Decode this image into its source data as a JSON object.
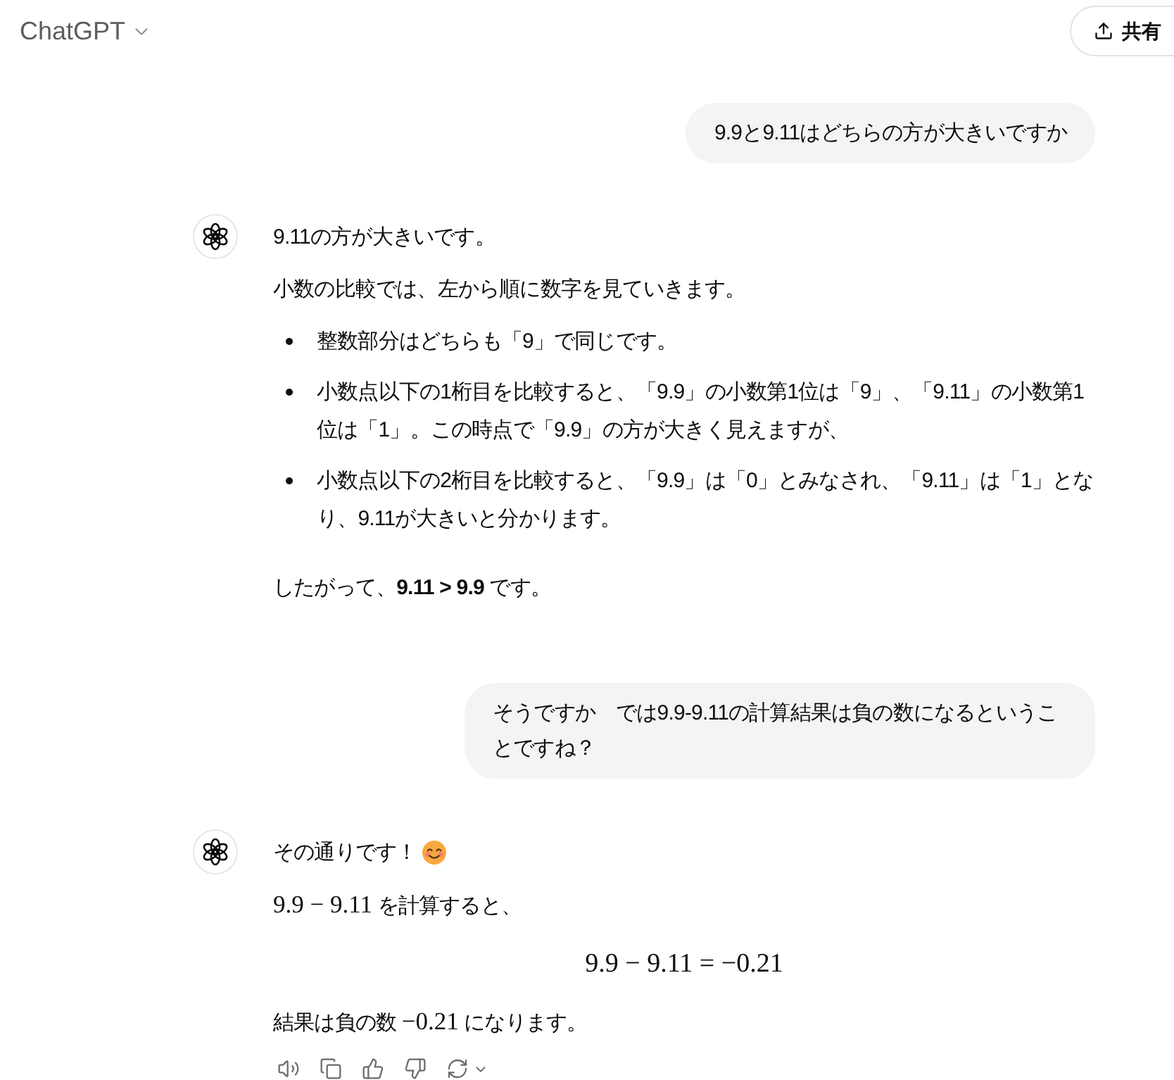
{
  "header": {
    "title": "ChatGPT",
    "share_button": "共有"
  },
  "messages": [
    {
      "kind": "user",
      "text": "9.9と9.11はどちらの方が大きいですか"
    },
    {
      "kind": "assistant",
      "blocks": [
        {
          "kind": "paragraph",
          "text": "9.11の方が大きいです。"
        },
        {
          "kind": "paragraph",
          "text": "小数の比較では、左から順に数字を見ていきます。"
        },
        {
          "kind": "list",
          "items": [
            "整数部分はどちらも「9」で同じです。",
            "小数点以下の1桁目を比較すると、「9.9」の小数第1位は「9」、「9.11」の小数第1位は「1」。この時点で「9.9」の方が大きく見えますが、",
            "小数点以下の2桁目を比較すると、「9.9」は「0」とみなされ、「9.11」は「1」となり、9.11が大きいと分かります。"
          ]
        },
        {
          "kind": "paragraph",
          "text": "したがって、**9.11 > 9.9** です。"
        }
      ]
    },
    {
      "kind": "user",
      "text": "そうですか　では9.9-9.11の計算結果は負の数になるということですね？"
    },
    {
      "kind": "assistant",
      "blocks": [
        {
          "kind": "paragraph",
          "text": "その通りです！",
          "emoji": true
        },
        {
          "kind": "math_paragraph",
          "parts": [
            {
              "kind": "math",
              "text": "9.9 − 9.11"
            },
            {
              "kind": "text",
              "text": " を計算すると、"
            }
          ]
        },
        {
          "kind": "display_math",
          "text": "9.9 − 9.11 = −0.21"
        },
        {
          "kind": "math_paragraph",
          "parts": [
            {
              "kind": "text",
              "text": "結果は負の数 "
            },
            {
              "kind": "math",
              "text": "−0.21"
            },
            {
              "kind": "text",
              "text": " になります。"
            }
          ]
        }
      ],
      "actions": [
        {
          "kind": "read_aloud"
        },
        {
          "kind": "copy"
        },
        {
          "kind": "like"
        },
        {
          "kind": "dislike"
        },
        {
          "kind": "regenerate"
        }
      ]
    }
  ]
}
